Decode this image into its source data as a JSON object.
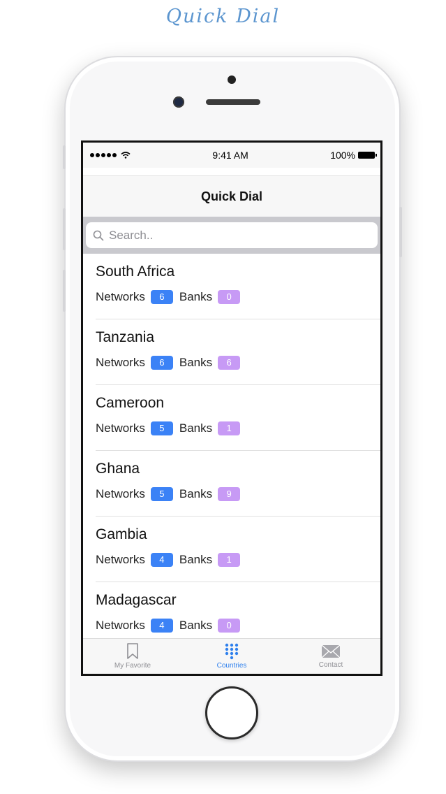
{
  "promo": {
    "title": "Quick Dial"
  },
  "status_bar": {
    "time": "9:41 AM",
    "battery": "100%"
  },
  "nav": {
    "title": "Quick Dial"
  },
  "search": {
    "placeholder": "Search.."
  },
  "labels": {
    "networks": "Networks",
    "banks": "Banks"
  },
  "countries": [
    {
      "name": "South Africa",
      "networks": "6",
      "banks": "0"
    },
    {
      "name": "Tanzania",
      "networks": "6",
      "banks": "6"
    },
    {
      "name": "Cameroon",
      "networks": "5",
      "banks": "1"
    },
    {
      "name": "Ghana",
      "networks": "5",
      "banks": "9"
    },
    {
      "name": "Gambia",
      "networks": "4",
      "banks": "1"
    },
    {
      "name": "Madagascar",
      "networks": "4",
      "banks": "0"
    }
  ],
  "tabs": [
    {
      "label": "My Favorite",
      "icon": "bookmark-icon"
    },
    {
      "label": "Countries",
      "icon": "keypad-icon",
      "active": true
    },
    {
      "label": "Contact",
      "icon": "envelope-icon"
    }
  ],
  "colors": {
    "networks_badge": "#3b82f6",
    "banks_badge": "#c79af5",
    "active_tab": "#2f80ed",
    "promo_title": "#5b95cf"
  }
}
